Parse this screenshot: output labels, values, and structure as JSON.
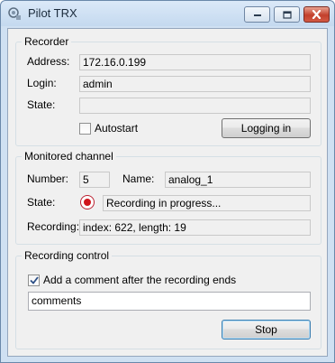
{
  "window": {
    "title": "Pilot TRX",
    "icon": "app-icon",
    "controls": [
      "minimize-icon",
      "maximize-icon",
      "close-icon"
    ]
  },
  "recorder": {
    "title": "Recorder",
    "address_label": "Address:",
    "address_value": "172.16.0.199",
    "login_label": "Login:",
    "login_value": "admin",
    "state_label": "State:",
    "state_value": "",
    "autostart_label": "Autostart",
    "autostart_checked": false,
    "logging_button": "Logging in"
  },
  "monitored": {
    "title": "Monitored channel",
    "number_label": "Number:",
    "number_value": "5",
    "name_label": "Name:",
    "name_value": "analog_1",
    "state_label": "State:",
    "state_value": "Recording in progress...",
    "state_icon": "record-icon",
    "recording_label": "Recording:",
    "recording_value": "index: 622, length: 19"
  },
  "control": {
    "title": "Recording control",
    "comment_checkbox_label": "Add a comment after the recording ends",
    "comment_checked": true,
    "comment_value": "comments",
    "stop_button": "Stop"
  },
  "colors": {
    "record_red": "#d0141b",
    "focus_border": "#3c7fb1"
  }
}
